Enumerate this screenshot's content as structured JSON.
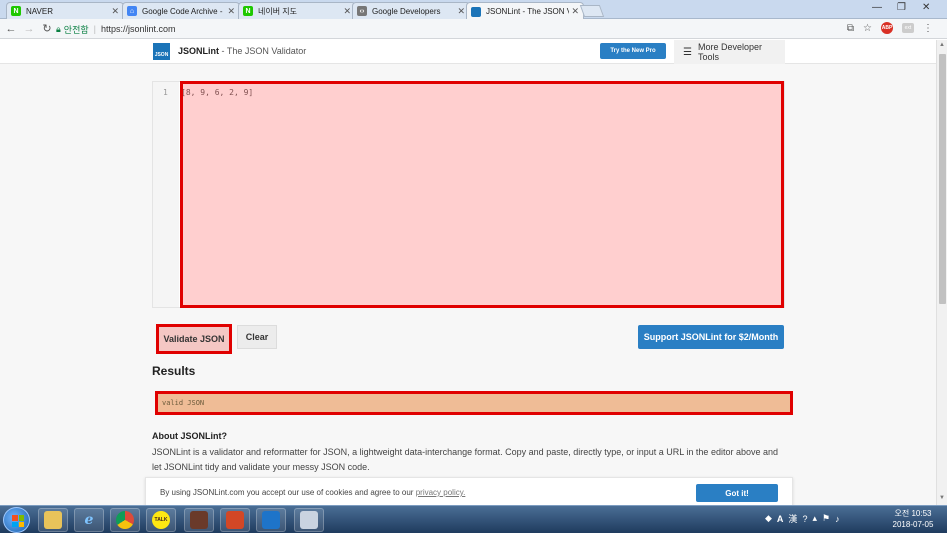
{
  "browser": {
    "tabs": [
      {
        "title": "NAVER",
        "favicon": "N",
        "favicon_color": "#1ec800",
        "active": false
      },
      {
        "title": "Google Code Archive - L",
        "favicon": "⌂",
        "favicon_color": "#4285f4",
        "active": false
      },
      {
        "title": "네이버 지도",
        "favicon": "N",
        "favicon_color": "#1ec800",
        "active": false
      },
      {
        "title": "Google Developers",
        "favicon": "‹›",
        "favicon_color": "#777777",
        "active": false
      },
      {
        "title": "JSONLint - The JSON Va",
        "favicon": "",
        "favicon_color": "#1b74b8",
        "active": true
      }
    ],
    "secure_label": "안전함",
    "url": "https://jsonlint.com"
  },
  "site": {
    "logo_text": "JSON",
    "brand_name": "JSONLint",
    "brand_sub": " - The JSON Validator",
    "pro_button": "Try the New Pro",
    "dev_tools": "More Developer Tools"
  },
  "editor": {
    "line_number": "1",
    "code": "[8, 9, 6, 2, 9]"
  },
  "actions": {
    "validate": "Validate JSON",
    "clear": "Clear",
    "support": "Support JSONLint for $2/Month"
  },
  "results": {
    "heading": "Results",
    "message": "valid JSON"
  },
  "about": {
    "heading": "About JSONLint?",
    "body": "JSONLint is a validator and reformatter for JSON, a lightweight data-interchange format. Copy and paste, directly type, or input a URL in the editor above and let JSONLint tidy and validate your messy JSON code."
  },
  "cookie": {
    "text": "By using JSONLint.com you accept our use of cookies and agree to our ",
    "link": "privacy policy.",
    "button": "Got it!"
  },
  "taskbar": {
    "apps": [
      {
        "name": "explorer",
        "label": "",
        "color": "#e8c35a"
      },
      {
        "name": "ie",
        "label": "e",
        "color": "#1e90ff"
      },
      {
        "name": "chrome",
        "label": "",
        "color": "#dd4b39"
      },
      {
        "name": "kakaotalk",
        "label": "TALK",
        "color": "#ffe812"
      },
      {
        "name": "app5",
        "label": "",
        "color": "#6a3a2a"
      },
      {
        "name": "powerpoint",
        "label": "",
        "color": "#d24726"
      },
      {
        "name": "vscode",
        "label": "",
        "color": "#1e74c9"
      },
      {
        "name": "snipping",
        "label": "",
        "color": "#c9d3e0"
      }
    ],
    "ime": "A",
    "ime2": "漢",
    "clock_time": "오전 10:53",
    "clock_date": "2018-07-05"
  },
  "colors": {
    "accent": "#2a7fc4",
    "highlight_border": "#e00000",
    "result_bg": "#efbc96"
  }
}
